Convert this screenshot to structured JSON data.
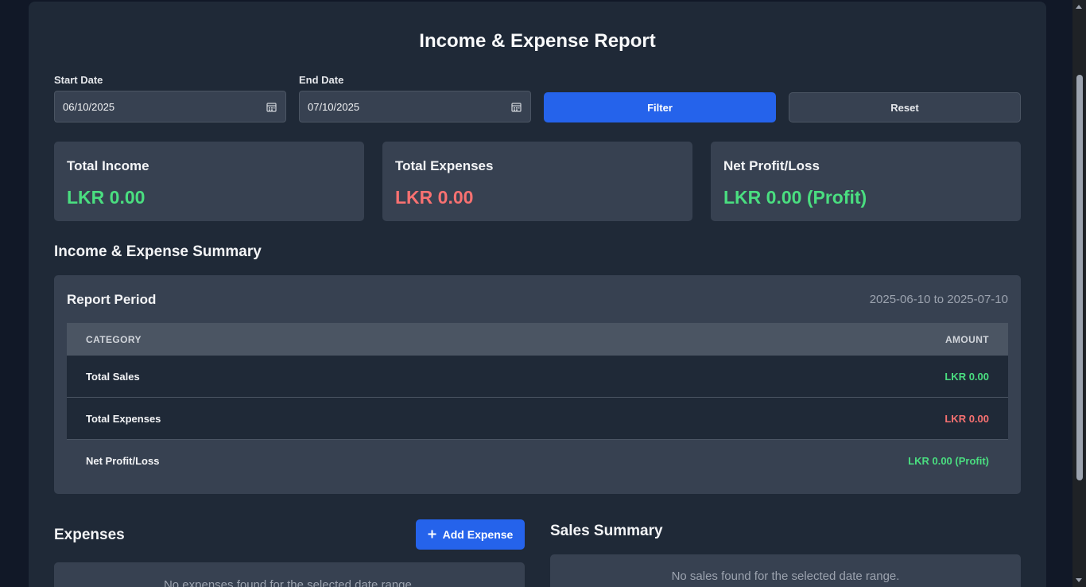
{
  "report": {
    "title": "Income & Expense Report"
  },
  "filters": {
    "start_label": "Start Date",
    "start_value": "06/10/2025",
    "end_label": "End Date",
    "end_value": "07/10/2025",
    "filter_label": "Filter",
    "reset_label": "Reset"
  },
  "cards": {
    "income": {
      "title": "Total Income",
      "value": "LKR 0.00"
    },
    "expenses": {
      "title": "Total Expenses",
      "value": "LKR 0.00"
    },
    "net": {
      "title": "Net Profit/Loss",
      "value": "LKR 0.00 (Profit)"
    }
  },
  "summary": {
    "section_title": "Income & Expense Summary",
    "period_label": "Report Period",
    "period_range": "2025-06-10 to 2025-07-10",
    "headers": {
      "category": "CATEGORY",
      "amount": "AMOUNT"
    },
    "rows": [
      {
        "category": "Total Sales",
        "amount": "LKR 0.00"
      },
      {
        "category": "Total Expenses",
        "amount": "LKR 0.00"
      },
      {
        "category": "Net Profit/Loss",
        "amount": "LKR 0.00 (Profit)"
      }
    ]
  },
  "expenses": {
    "section_title": "Expenses",
    "add_label": "Add Expense",
    "empty_text": "No expenses found for the selected date range."
  },
  "sales": {
    "section_title": "Sales Summary",
    "empty_text": "No sales found for the selected date range."
  },
  "colors": {
    "accent": "#2563eb",
    "positive": "#4ade80",
    "negative": "#f87171"
  },
  "icons": [
    "calendar-icon",
    "plus-icon"
  ]
}
